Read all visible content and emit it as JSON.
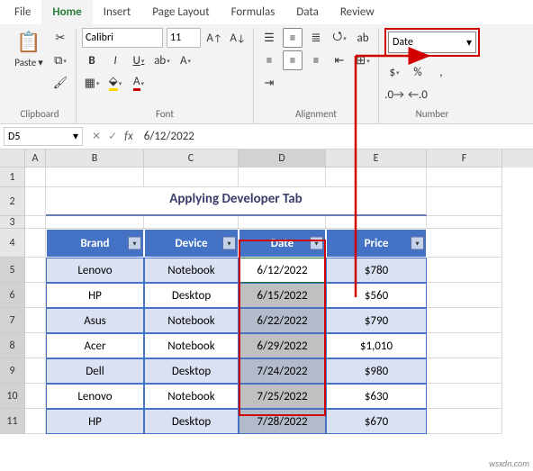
{
  "tabs": [
    "File",
    "Home",
    "Insert",
    "Page Layout",
    "Formulas",
    "Data",
    "Review"
  ],
  "active_tab": "Home",
  "clipboard": {
    "paste_label": "Paste",
    "group_label": "Clipboard"
  },
  "font": {
    "name": "Calibri",
    "size": "11",
    "group_label": "Font",
    "bold": "B",
    "italic": "I",
    "underline": "U"
  },
  "alignment": {
    "group_label": "Alignment",
    "wrap_symbol": "ab"
  },
  "number": {
    "format": "Date",
    "group_label": "Number",
    "currency": "$",
    "percent": "%",
    "comma": ","
  },
  "namebox": "D5",
  "formula": "6/12/2022",
  "columns": [
    "A",
    "B",
    "C",
    "D",
    "E",
    "F"
  ],
  "row_nums": [
    "1",
    "2",
    "3",
    "4",
    "5",
    "6",
    "7",
    "8",
    "9",
    "10",
    "11"
  ],
  "title": "Applying Developer Tab",
  "headers": {
    "brand": "Brand",
    "device": "Device",
    "date": "Date",
    "price": "Price"
  },
  "rows": [
    {
      "brand": "Lenovo",
      "device": "Notebook",
      "date": "6/12/2022",
      "price": "$780"
    },
    {
      "brand": "HP",
      "device": "Desktop",
      "date": "6/15/2022",
      "price": "$560"
    },
    {
      "brand": "Asus",
      "device": "Notebook",
      "date": "6/22/2022",
      "price": "$790"
    },
    {
      "brand": "Acer",
      "device": "Notebook",
      "date": "6/29/2022",
      "price": "$1,010"
    },
    {
      "brand": "Dell",
      "device": "Desktop",
      "date": "7/24/2022",
      "price": "$980"
    },
    {
      "brand": "Lenovo",
      "device": "Notebook",
      "date": "7/25/2022",
      "price": "$630"
    },
    {
      "brand": "HP",
      "device": "Desktop",
      "date": "7/28/2022",
      "price": "$670"
    }
  ],
  "watermark": "wsxdn.com"
}
